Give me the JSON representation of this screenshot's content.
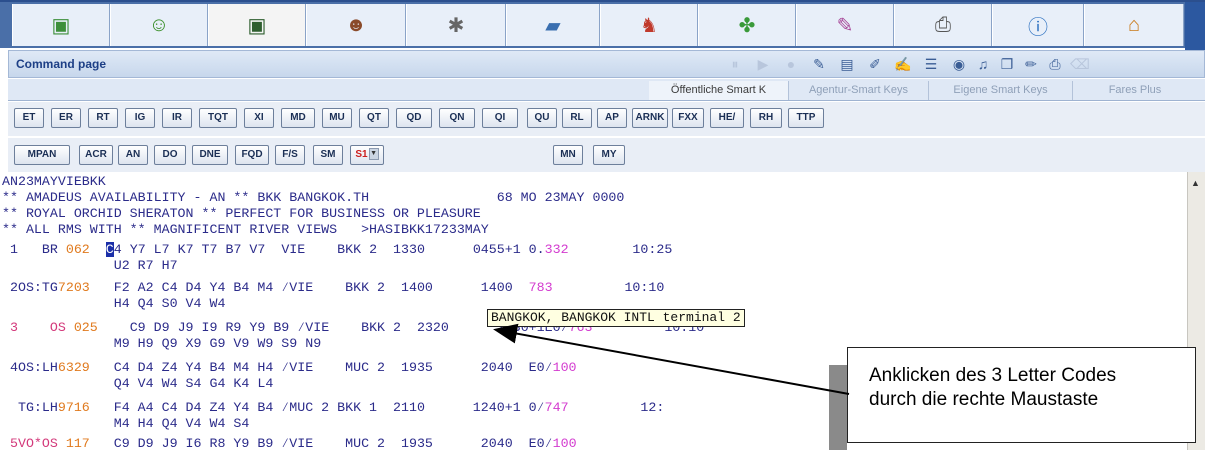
{
  "toolbar": {
    "icons": [
      "cube-icon",
      "smiley-icon",
      "terminal-icon",
      "person-icon",
      "chandelier-icon",
      "car-icon",
      "bellboy-icon",
      "puzzle-icon",
      "note-icon",
      "printer-icon",
      "info-icon",
      "home-icon"
    ],
    "glyphs": [
      "▣",
      "☺",
      "▣",
      "☻",
      "✱",
      "▰",
      "♞",
      "✤",
      "✎",
      "⎙",
      "ⓘ",
      "⌂"
    ]
  },
  "command_page": {
    "title": "Command page"
  },
  "smart_tabs": [
    {
      "label": "Öffentliche Smart K",
      "active": true
    },
    {
      "label": "Agentur-Smart Keys",
      "active": false
    },
    {
      "label": "Eigene Smart Keys",
      "active": false
    },
    {
      "label": "Fares Plus",
      "active": false
    }
  ],
  "buttons_row1": [
    "ET",
    "ER",
    "RT",
    "IG",
    "IR",
    "TQT",
    "XI",
    "MD",
    "MU",
    "QT",
    "QD",
    "QN",
    "QI",
    "QU",
    "RL",
    "AP",
    "ARNK",
    "FXX",
    "HE/",
    "RH",
    "TTP"
  ],
  "buttons_row2": [
    "MPAN",
    "ACR",
    "AN",
    "DO",
    "DNE",
    "FQD",
    "F/S",
    "SM",
    "S1",
    "MN",
    "MY"
  ],
  "terminal": {
    "l1": "AN23MAYVIEBKK",
    "l2": "** AMADEUS AVAILABILITY - AN ** BKK BANGKOK.TH                68 MO 23MAY 0000",
    "l3": "** ROYAL ORCHID SHERATON ** PERFECT FOR BUSINESS OR PLEASURE",
    "l4": "** ALL RMS WITH ** MAGNIFICENT RIVER VIEWS   >HASIBKK17233MAY",
    "r1a": " 1   BR ",
    "r1b": "062",
    "r1c": "  ",
    "r1cur": "C",
    "r1d": "4 Y7 L7 K7 T7 B7 V7  VIE    BKK 2  1330      0455+1 0.",
    "r1e": "332",
    "r1f": "        10:25",
    "r1g": "              U2 R7 H7",
    "r2a": " 2OS:TG",
    "r2b": "7203",
    "r2c": "   F2 A2 C4 D4 Y4 B4 M4 ⁄VIE    BKK 2  1400      ",
    "r2d": "1400",
    "r2e": "  ",
    "r2f": "783",
    "r2g": "         10:10",
    "r2h": "              H4 Q4 S0 V4 W4",
    "r3a": " 3    OS ",
    "r3b": "025",
    "r3c": "    C9 D9 J9 I9 R9 Y9 B9 ⁄VIE    BKK 2  2320      1430+1E0⁄",
    "r3d": "763",
    "r3e": "         10:10",
    "r3f": "              M9 H9 Q9 X9 G9 V9 W9 S9 N9",
    "r4a": " 4OS:LH",
    "r4b": "6329",
    "r4c": "   C4 D4 Z4 Y4 B4 M4 H4 ⁄VIE    MUC 2  1935      2040  E0⁄",
    "r4d": "100",
    "r4e": "              Q4 V4 W4 S4 G4 K4 L4",
    "r5a": "  TG:LH",
    "r5b": "9716",
    "r5c": "   F4 A4 C4 D4 Z4 Y4 B4 ⁄MUC 2 BKK 1  2110      1240+1 0⁄",
    "r5d": "747",
    "r5e": "         12:",
    "r5f": "              M4 H4 Q4 V4 W4 S4",
    "r6a": " 5VO*OS ",
    "r6b": "117",
    "r6c": "   C9 D9 J9 I6 R8 Y9 B9 ⁄VIE    MUC 2  1935      2040  E0⁄",
    "r6d": "100"
  },
  "tooltip": "BANGKOK, BANGKOK INTL terminal 2",
  "callout": {
    "line1": "Anklicken des 3 Letter Codes",
    "line2": "durch die rechte Maustaste"
  }
}
